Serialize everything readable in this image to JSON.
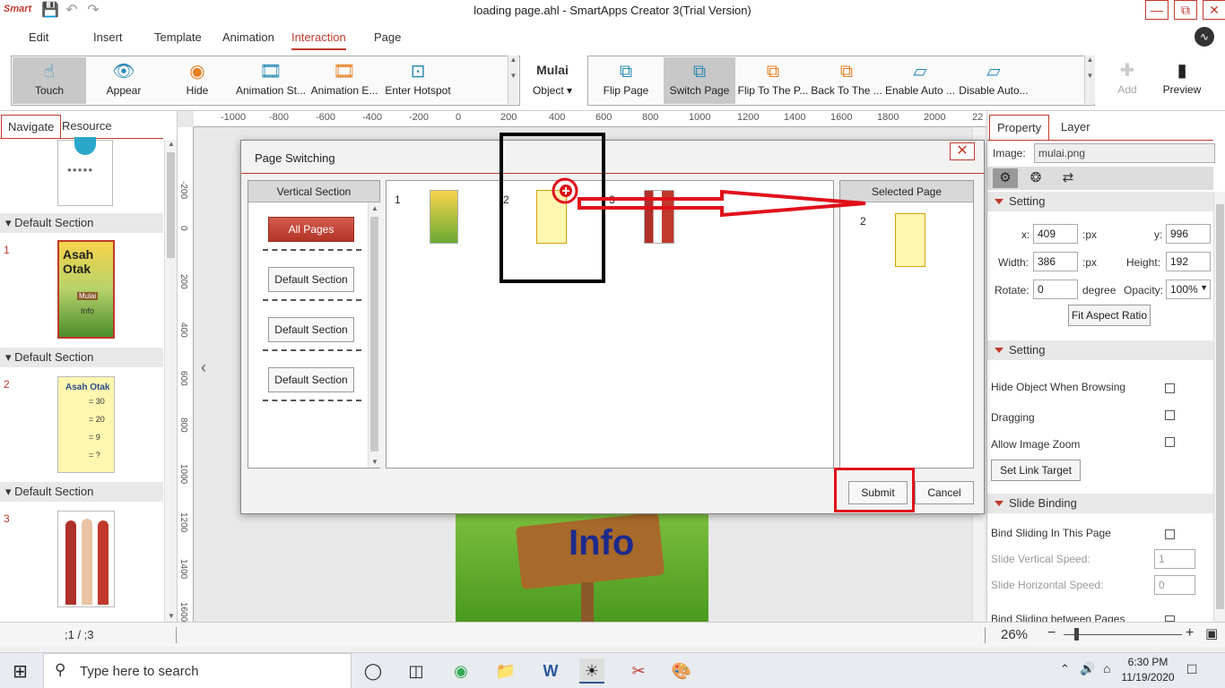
{
  "window": {
    "app_logo": "Smart",
    "title": "loading page.ahl - SmartApps Creator 3(Trial Version)"
  },
  "menu": {
    "items": [
      "Edit",
      "Insert",
      "Template",
      "Animation",
      "Interaction",
      "Page"
    ],
    "active": "Interaction"
  },
  "ribbon": {
    "group1": [
      "Touch",
      "Appear",
      "Hide",
      "Animation St...",
      "Animation E...",
      "Enter Hotspot"
    ],
    "object_thumb_text": "Mulai",
    "object_label": "Object",
    "group2": [
      "Flip Page",
      "Switch Page",
      "Flip To The P...",
      "Back To The ...",
      "Enable Auto ...",
      "Disable Auto..."
    ],
    "add_label": "Add",
    "preview_label": "Preview"
  },
  "left_panel": {
    "tabs": [
      "Navigate",
      "Resource"
    ],
    "sections": [
      "Default Section",
      "Default Section",
      "Default Section"
    ],
    "page_numbers": [
      "1",
      "2",
      "3"
    ],
    "thumb1_title": "Asah Otak",
    "thumb1_sub": "Mulai",
    "thumb1_info": "Info",
    "thumb2_title": "Asah Otak",
    "thumb2_rows": [
      "= 30",
      "= 20",
      "= 9",
      "= ?"
    ]
  },
  "canvas": {
    "ruler_h": [
      "-1000",
      "-800",
      "-600",
      "-400",
      "-200",
      "0",
      "200",
      "400",
      "600",
      "800",
      "1000",
      "1200",
      "1400",
      "1600",
      "1800",
      "2000",
      "22"
    ],
    "ruler_v": [
      "-200",
      "0",
      "200",
      "400",
      "600",
      "800",
      "1000",
      "1200",
      "1400",
      "1600"
    ],
    "info_text": "Info"
  },
  "right_panel": {
    "tabs": [
      "Property",
      "Layer"
    ],
    "image_label": "Image:",
    "image_value": "mulai.png",
    "setting1": "Setting",
    "x_label": "x:",
    "x_value": "409",
    "y_label": "y:",
    "y_value": "996",
    "px": ":px",
    "width_label": "Width:",
    "width_value": "386",
    "height_label": "Height:",
    "height_value": "192",
    "rotate_label": "Rotate:",
    "rotate_value": "0",
    "degree": "degree",
    "opacity_label": "Opacity:",
    "opacity_value": "100%",
    "fit_aspect": "Fit Aspect Ratio",
    "setting2": "Setting",
    "hide_object": "Hide Object When Browsing",
    "dragging": "Dragging",
    "allow_zoom": "Allow Image Zoom",
    "set_link": "Set Link Target",
    "slide_binding": "Slide Binding",
    "bind_sliding": "Bind Sliding In This Page",
    "slide_v": "Slide Vertical Speed:",
    "slide_v_value": "1",
    "slide_h": "Slide Horizontal Speed:",
    "slide_h_value": "0",
    "bind_between": "Bind Sliding between Pages"
  },
  "status": {
    "page_indicator": ";1  /  ;3",
    "zoom": "26%"
  },
  "dialog": {
    "title": "Page Switching",
    "vertical_section": "Vertical Section",
    "all_pages": "All Pages",
    "sections": [
      "Default Section",
      "Default Section",
      "Default Section"
    ],
    "page_nums": [
      "1",
      "2",
      "3"
    ],
    "selected_page": "Selected Page",
    "selected_num": "2",
    "submit": "Submit",
    "cancel": "Cancel"
  },
  "taskbar": {
    "search_placeholder": "Type here to search",
    "time": "6:30 PM",
    "date": "11/19/2020"
  },
  "colors": {
    "accent": "#c0392b",
    "annotation_red": "#e0101a"
  }
}
